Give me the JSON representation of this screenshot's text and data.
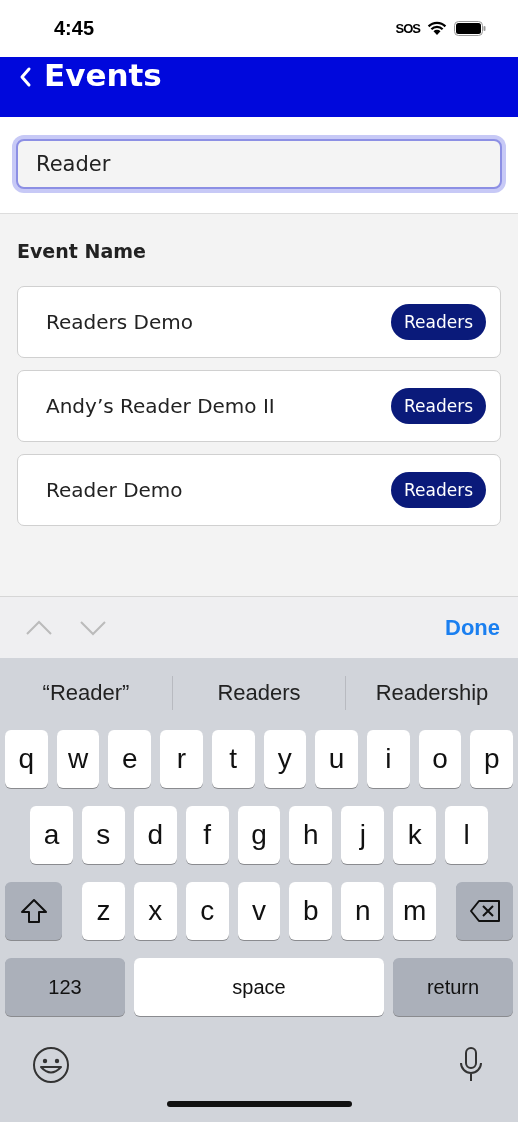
{
  "status_bar": {
    "time": "4:45",
    "sos": "SOS"
  },
  "header": {
    "title": "Events"
  },
  "search": {
    "value": "Reader"
  },
  "section_title": "Event Name",
  "events": [
    {
      "name": "Readers Demo",
      "badge": "Readers"
    },
    {
      "name": "Andy’s Reader Demo II",
      "badge": "Readers"
    },
    {
      "name": "Reader Demo",
      "badge": "Readers"
    }
  ],
  "accessory_bar": {
    "done": "Done"
  },
  "suggestions": [
    "“Reader”",
    "Readers",
    "Readership"
  ],
  "keyboard": {
    "rows": [
      [
        "q",
        "w",
        "e",
        "r",
        "t",
        "y",
        "u",
        "i",
        "o",
        "p"
      ],
      [
        "a",
        "s",
        "d",
        "f",
        "g",
        "h",
        "j",
        "k",
        "l"
      ],
      [
        "z",
        "x",
        "c",
        "v",
        "b",
        "n",
        "m"
      ]
    ],
    "numbers": "123",
    "space": "space",
    "return": "return"
  }
}
